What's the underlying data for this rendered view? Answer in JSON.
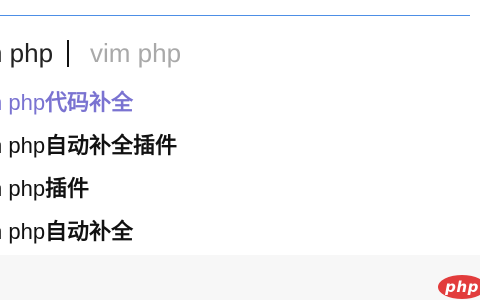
{
  "search": {
    "typed_text": "n php",
    "ghost_completion": "vim php"
  },
  "suggestions": [
    {
      "prefix": "n php",
      "rest": "代码补全",
      "active": true
    },
    {
      "prefix": "n php",
      "rest": "自动补全插件",
      "active": false
    },
    {
      "prefix": "n php",
      "rest": "插件",
      "active": false
    },
    {
      "prefix": "n php",
      "rest": "自动补全",
      "active": false
    }
  ],
  "watermark": {
    "text": "php"
  },
  "colors": {
    "active_suggestion": "#7a73d1",
    "focus_border": "#4d8fe6",
    "logo_bg": "#e23c3c"
  }
}
